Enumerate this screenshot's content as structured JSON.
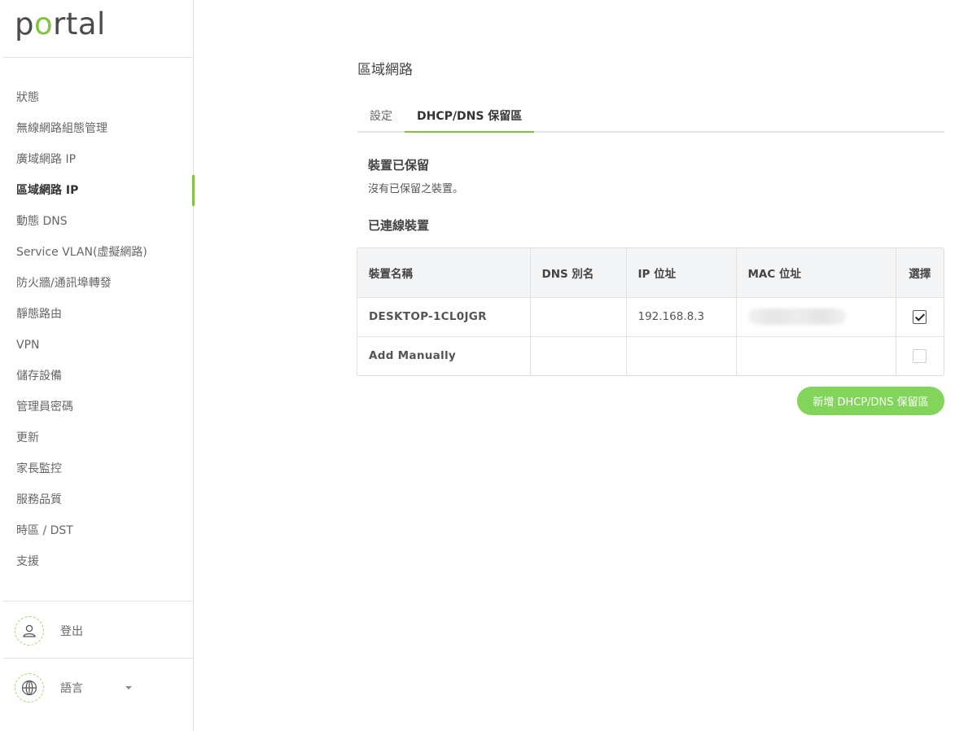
{
  "brand": {
    "logo_pre": "p",
    "logo_o": "o",
    "logo_post": "rtal",
    "accent_color": "#82c341"
  },
  "sidebar": {
    "items": [
      {
        "label": "狀態",
        "active": false
      },
      {
        "label": "無線網路組態管理",
        "active": false
      },
      {
        "label": "廣域網路 IP",
        "active": false
      },
      {
        "label": "區域網路 IP",
        "active": true
      },
      {
        "label": "動態 DNS",
        "active": false
      },
      {
        "label": "Service VLAN(虛擬網路)",
        "active": false
      },
      {
        "label": "防火牆/通訊埠轉發",
        "active": false
      },
      {
        "label": "靜態路由",
        "active": false
      },
      {
        "label": "VPN",
        "active": false
      },
      {
        "label": "儲存設備",
        "active": false
      },
      {
        "label": "管理員密碼",
        "active": false
      },
      {
        "label": "更新",
        "active": false
      },
      {
        "label": "家長監控",
        "active": false
      },
      {
        "label": "服務品質",
        "active": false
      },
      {
        "label": "時區 / DST",
        "active": false
      },
      {
        "label": "支援",
        "active": false
      }
    ],
    "logout": {
      "label": "登出",
      "icon": "user-icon"
    },
    "language": {
      "label": "語言",
      "icon": "globe-icon"
    }
  },
  "main": {
    "title": "區域網路",
    "tabs": [
      {
        "label": "設定",
        "active": false
      },
      {
        "label": "DHCP/DNS 保留區",
        "active": true
      }
    ],
    "reserved": {
      "title": "裝置已保留",
      "empty_text": "沒有已保留之裝置。"
    },
    "connected": {
      "title": "已連線裝置",
      "columns": [
        "裝置名稱",
        "DNS 別名",
        "IP 位址",
        "MAC 位址",
        "選擇"
      ],
      "rows": [
        {
          "name": "DESKTOP-1CL0JGR",
          "dns": "",
          "ip": "192.168.8.3",
          "mac_blurred": true,
          "selected": true
        },
        {
          "name": "Add Manually",
          "dns": "",
          "ip": "",
          "mac_blurred": false,
          "selected": false
        }
      ]
    },
    "add_button": "新增 DHCP/DNS 保留區"
  }
}
